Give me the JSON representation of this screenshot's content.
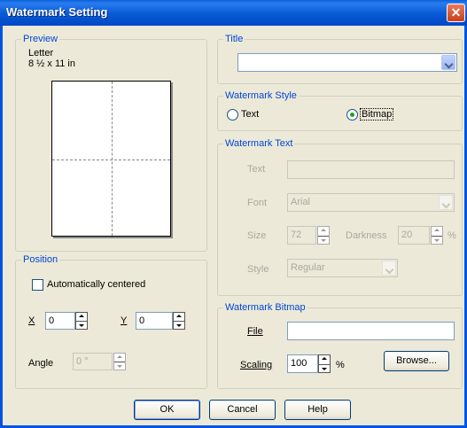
{
  "window": {
    "title": "Watermark Setting",
    "close_glyph": "✕"
  },
  "preview": {
    "legend": "Preview",
    "paper_name": "Letter",
    "paper_size": "8 ½ x 11 in"
  },
  "position": {
    "legend": "Position",
    "auto_center_label": "Automatically centered",
    "auto_center_checked": false,
    "x_label": "X",
    "x_value": "0",
    "y_label": "Y",
    "y_value": "0",
    "angle_label": "Angle",
    "angle_value": "0 °"
  },
  "title_group": {
    "legend": "Title",
    "value": ""
  },
  "watermark_style": {
    "legend": "Watermark Style",
    "options": [
      {
        "label": "Text",
        "selected": false
      },
      {
        "label": "Bitmap",
        "selected": true
      }
    ]
  },
  "watermark_text": {
    "legend": "Watermark Text",
    "text_label": "Text",
    "text_value": "",
    "font_label": "Font",
    "font_value": "Arial",
    "size_label": "Size",
    "size_value": "72",
    "darkness_label": "Darkness",
    "darkness_value": "20",
    "darkness_unit": "%",
    "style_label": "Style",
    "style_value": "Regular"
  },
  "watermark_bitmap": {
    "legend": "Watermark Bitmap",
    "file_label": "File",
    "file_value": "",
    "scaling_label": "Scaling",
    "scaling_value": "100",
    "scaling_unit": "%",
    "browse_label": "Browse..."
  },
  "buttons": {
    "ok": "OK",
    "cancel": "Cancel",
    "help": "Help"
  },
  "colors": {
    "titlebar": "#0a5dd6",
    "dialog_bg": "#ece9d8",
    "group_label": "#0046d5"
  }
}
